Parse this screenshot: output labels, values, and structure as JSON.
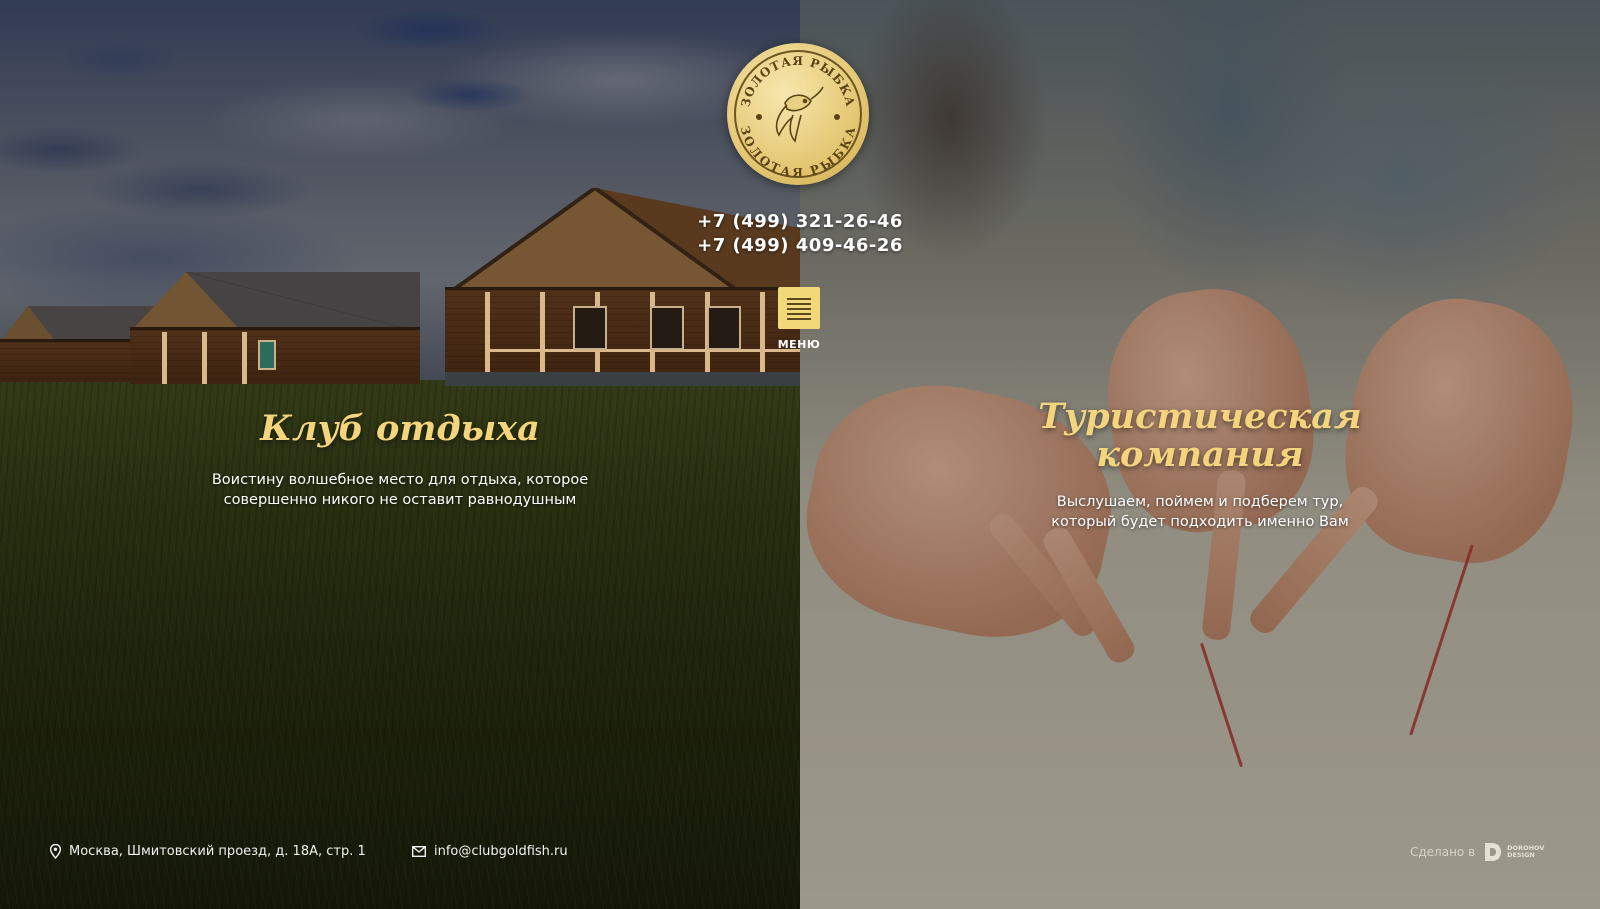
{
  "brand": {
    "logo_text_top": "ЗОЛОТАЯ РЫБКА",
    "logo_text_bottom": "ЗОЛОТАЯ РЫБКА",
    "icon": "goldfish-logo"
  },
  "contacts": {
    "phones": [
      "+7 (499) 321-26-46",
      "+7 (499) 409-46-26"
    ]
  },
  "menu": {
    "label": "МЕНЮ",
    "icon": "hamburger-icon"
  },
  "sections": {
    "club": {
      "title": "Клуб отдыха",
      "description_line1": "Воистину волшебное место для отдыха, которое",
      "description_line2": "совершенно никого не оставит равнодушным"
    },
    "tour": {
      "title_line1": "Туристическая",
      "title_line2": "компания",
      "description_line1": "Выслушаем, поймем и подберем тур,",
      "description_line2": "который будет подходить именно Вам"
    }
  },
  "footer": {
    "address": "Москва, Шмитовский проезд, д. 18А, стр. 1",
    "email": "info@clubgoldfish.ru",
    "credit_prefix": "Сделано в",
    "credit_brand_line1": "DOROHOV",
    "credit_brand_line2": "DESIGN"
  },
  "colors": {
    "accent_gold": "#f4d47c",
    "menu_button": "#f2d879",
    "text_white": "#ffffff"
  }
}
